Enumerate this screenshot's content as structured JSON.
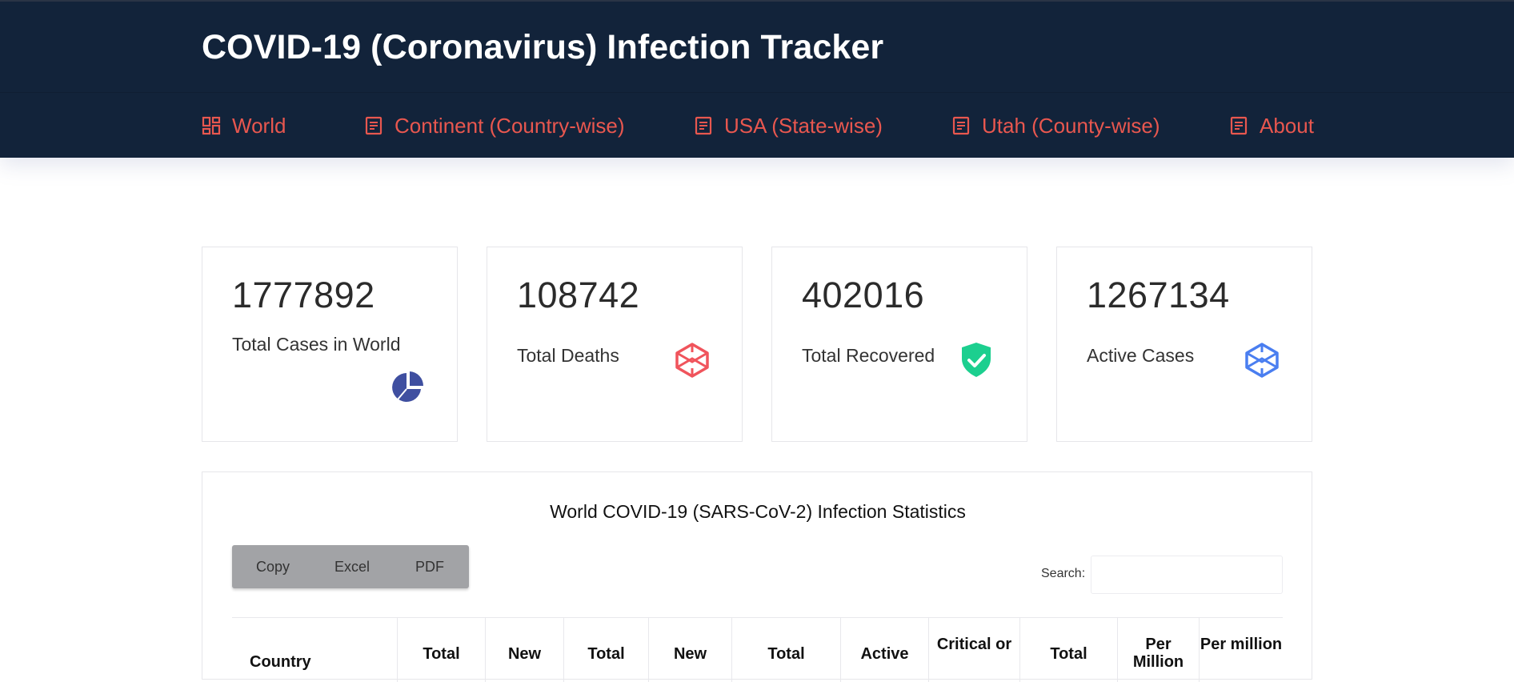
{
  "header": {
    "title": "COVID-19 (Coronavirus) Infection Tracker",
    "nav": [
      {
        "label": "World",
        "icon": "dashboard-icon"
      },
      {
        "label": "Continent (Country-wise)",
        "icon": "document-icon"
      },
      {
        "label": "USA (State-wise)",
        "icon": "document-icon"
      },
      {
        "label": "Utah (County-wise)",
        "icon": "document-icon"
      },
      {
        "label": "About",
        "icon": "document-icon"
      }
    ],
    "background_color": "#12233a",
    "accent_color": "#e8574f"
  },
  "stats": [
    {
      "value": "1777892",
      "label": "Total Cases in World",
      "icon": "pie-chart-icon",
      "color": "#3f4fa0"
    },
    {
      "value": "108742",
      "label": "Total Deaths",
      "icon": "cube-icon",
      "color": "#f0545c"
    },
    {
      "value": "402016",
      "label": "Total Recovered",
      "icon": "shield-check-icon",
      "color": "#1ccf8f"
    },
    {
      "value": "1267134",
      "label": "Active Cases",
      "icon": "cube-icon",
      "color": "#4a7ef0"
    }
  ],
  "table_panel": {
    "title": "World COVID-19 (SARS-CoV-2) Infection Statistics",
    "buttons": [
      "Copy",
      "Excel",
      "PDF"
    ],
    "search_label": "Search:",
    "search_value": "",
    "columns": [
      "Country",
      "Total",
      "New",
      "Total",
      "New",
      "Total",
      "Active",
      "Critical or",
      "Total",
      "Per Million",
      "Per million"
    ]
  }
}
